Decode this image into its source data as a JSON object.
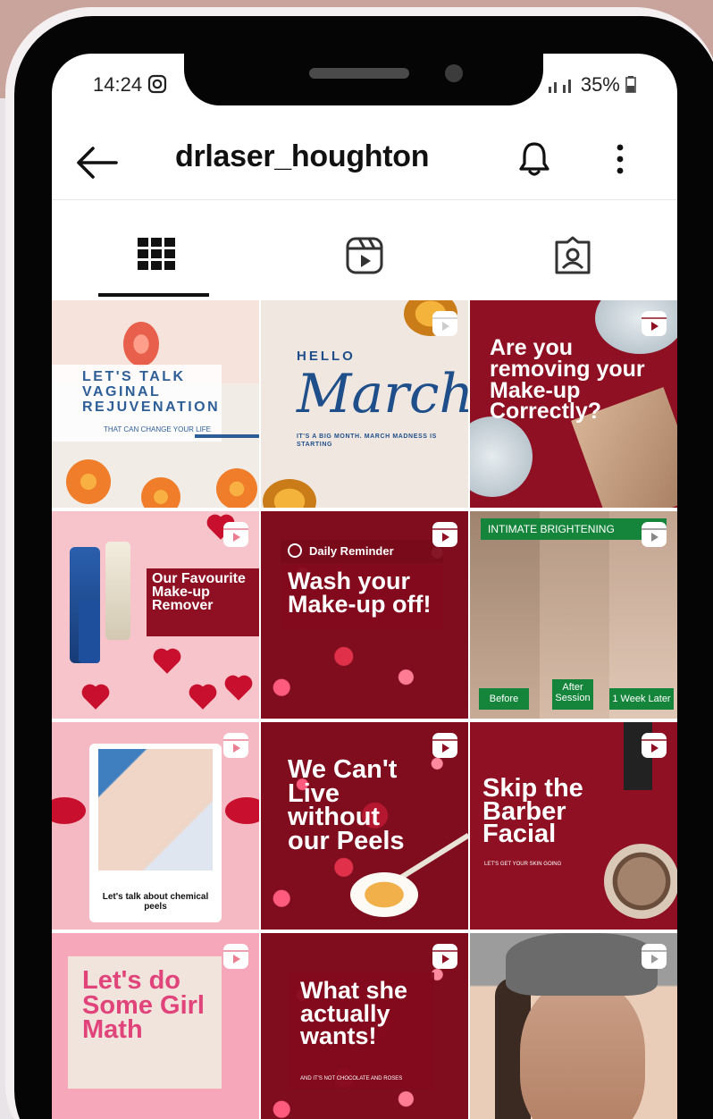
{
  "status_bar": {
    "time": "14:24",
    "battery": "35%"
  },
  "header": {
    "username": "drlaser_houghton"
  },
  "tabs": [
    "posts-grid",
    "reels",
    "tagged"
  ],
  "posts": [
    {
      "lines": [
        "LET'S TALK",
        "VAGINAL",
        "REJUVENATION"
      ],
      "sub": "THAT CAN CHANGE YOUR LIFE"
    },
    {
      "hello": "HELLO",
      "script": "March",
      "small": "IT'S A BIG MONTH. MARCH MADNESS IS STARTING"
    },
    {
      "text": "Are you removing your Make-up Correctly?"
    },
    {
      "text": "Our Favourite Make-up Remover"
    },
    {
      "reminder": "Daily Reminder",
      "text": "Wash your Make-up off!"
    },
    {
      "banner": "INTIMATE BRIGHTENING",
      "before": "Before",
      "after": "After Session",
      "later": "1 Week Later"
    },
    {
      "caption": "Let's talk about chemical peels"
    },
    {
      "text": "We Can't Live without our Peels"
    },
    {
      "text": "Skip the Barber Facial",
      "small": "LET'S GET YOUR SKIN GOING"
    },
    {
      "text": "Let's do Some Girl Math"
    },
    {
      "text": "What she actually wants!",
      "small": "AND IT'S NOT CHOCOLATE AND ROSES"
    },
    {
      "text": ""
    }
  ],
  "colors": {
    "brand_red": "#8e1022",
    "ink": "#111111",
    "accent_blue": "#2d5e97",
    "green_label": "#14853b"
  },
  "icons": [
    "back-arrow-icon",
    "bell-icon",
    "more-vertical-icon",
    "grid-icon",
    "reels-icon",
    "tagged-icon",
    "reel-badge-icon"
  ]
}
